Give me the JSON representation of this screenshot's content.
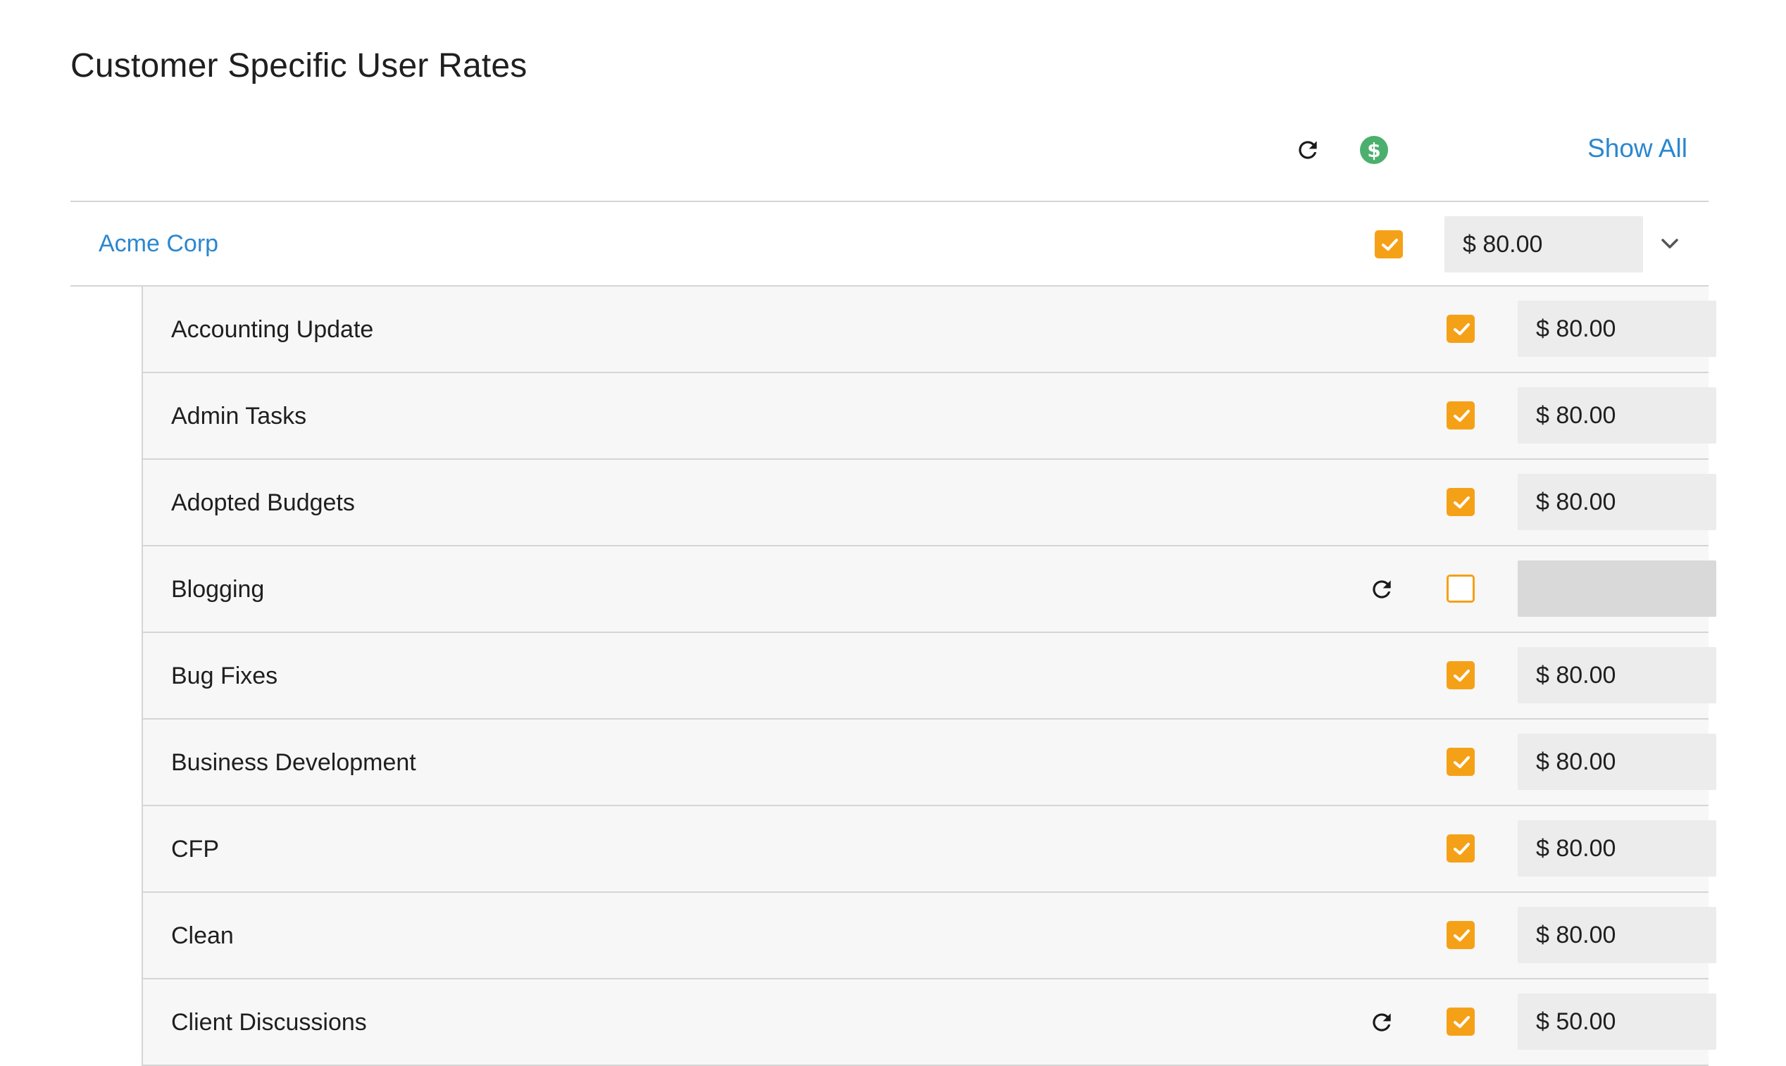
{
  "page": {
    "title": "Customer Specific User Rates"
  },
  "toolbar": {
    "reset_icon": "refresh-icon",
    "billable_icon": "dollar-circle-icon",
    "show_all_label": "Show All"
  },
  "colors": {
    "accent_blue": "#2b87cf",
    "checkbox_orange": "#f5a118",
    "dollar_green": "#4caf6e"
  },
  "customer": {
    "name": "Acme Corp",
    "billable": true,
    "rate": "$ 80.00",
    "expanded": true
  },
  "tasks": [
    {
      "name": "Accounting Update",
      "billable": true,
      "rate": "$ 80.00",
      "has_reset": false
    },
    {
      "name": "Admin Tasks",
      "billable": true,
      "rate": "$ 80.00",
      "has_reset": false
    },
    {
      "name": "Adopted Budgets",
      "billable": true,
      "rate": "$ 80.00",
      "has_reset": false
    },
    {
      "name": "Blogging",
      "billable": false,
      "rate": "",
      "has_reset": true
    },
    {
      "name": "Bug Fixes",
      "billable": true,
      "rate": "$ 80.00",
      "has_reset": false
    },
    {
      "name": "Business Development",
      "billable": true,
      "rate": "$ 80.00",
      "has_reset": false
    },
    {
      "name": "CFP",
      "billable": true,
      "rate": "$ 80.00",
      "has_reset": false
    },
    {
      "name": "Clean",
      "billable": true,
      "rate": "$ 80.00",
      "has_reset": false
    },
    {
      "name": "Client Discussions",
      "billable": true,
      "rate": "$ 50.00",
      "has_reset": true
    }
  ]
}
